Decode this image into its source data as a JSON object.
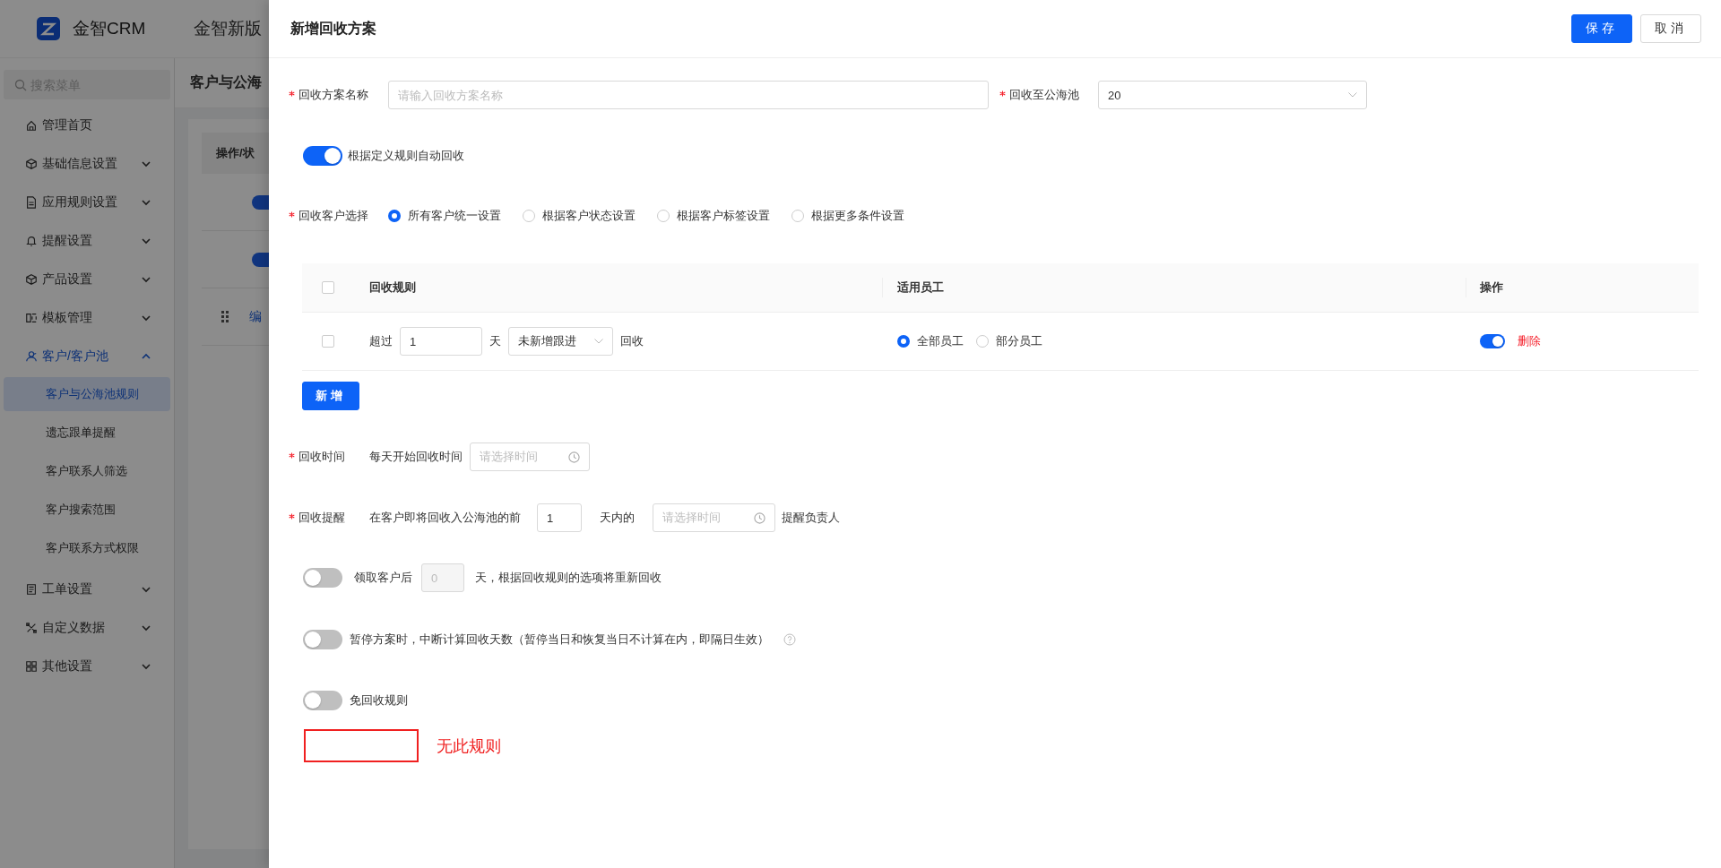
{
  "app": {
    "logo": "金智CRM",
    "title": "金智新版"
  },
  "sidebar": {
    "search_placeholder": "搜索菜单",
    "items": [
      {
        "label": "管理首页",
        "kind": "link",
        "selected": false
      },
      {
        "label": "基础信息设置",
        "kind": "group",
        "selected": false,
        "expanded": false
      },
      {
        "label": "应用规则设置",
        "kind": "group",
        "selected": false,
        "expanded": false
      },
      {
        "label": "提醒设置",
        "kind": "group",
        "selected": false,
        "expanded": false
      },
      {
        "label": "产品设置",
        "kind": "group",
        "selected": false,
        "expanded": false
      },
      {
        "label": "模板管理",
        "kind": "group",
        "selected": false,
        "expanded": false
      },
      {
        "label": "客户/客户池",
        "kind": "group",
        "selected": true,
        "expanded": true,
        "children": [
          {
            "label": "客户与公海池规则",
            "selected": true
          },
          {
            "label": "遗忘跟单提醒",
            "selected": false
          },
          {
            "label": "客户联系人筛选",
            "selected": false
          },
          {
            "label": "客户搜索范围",
            "selected": false
          },
          {
            "label": "客户联系方式权限",
            "selected": false
          }
        ]
      },
      {
        "label": "工单设置",
        "kind": "group",
        "selected": false,
        "expanded": false
      },
      {
        "label": "自定义数据",
        "kind": "group",
        "selected": false,
        "expanded": false
      },
      {
        "label": "其他设置",
        "kind": "group",
        "selected": false,
        "expanded": false
      }
    ]
  },
  "page": {
    "title": "客户与公海",
    "table_header": "操作/状",
    "rows": [
      {
        "kind": "toggle",
        "on": true
      },
      {
        "kind": "toggle",
        "on": true
      },
      {
        "kind": "link",
        "text": "编"
      }
    ]
  },
  "drawer": {
    "title": "新增回收方案",
    "buttons": [
      {
        "label": "保存",
        "kind": "primary"
      },
      {
        "label": "取消",
        "kind": "default"
      }
    ],
    "name_field": {
      "label": "回收方案名称",
      "required": true,
      "placeholder": "请输入回收方案名称"
    },
    "pool_field": {
      "label": "回收至公海池",
      "required": true,
      "value": "20"
    },
    "auto_recycle": {
      "label": "根据定义规则自动回收",
      "on": true
    },
    "customer_select": {
      "label": "回收客户选择",
      "required": true,
      "options": [
        {
          "label": "所有客户统一设置",
          "selected": true
        },
        {
          "label": "根据客户状态设置",
          "selected": false
        },
        {
          "label": "根据客户标签设置",
          "selected": false
        },
        {
          "label": "根据更多条件设置",
          "selected": false
        }
      ]
    },
    "rules_table": {
      "columns": [
        "回收规则",
        "适用员工",
        "操作"
      ],
      "header_checked": false,
      "rows": [
        {
          "checked": false,
          "prefix": "超过",
          "days": "1",
          "unit": "天",
          "condition": "未新增跟进",
          "suffix": "回收",
          "staff_options": [
            {
              "label": "全部员工",
              "selected": true
            },
            {
              "label": "部分员工",
              "selected": false
            }
          ],
          "enabled": true,
          "delete": "删除"
        }
      ]
    },
    "add_button": "新增",
    "recycle_time": {
      "label": "回收时间",
      "required": true,
      "text": "每天开始回收时间",
      "placeholder": "请选择时间"
    },
    "reminder": {
      "label": "回收提醒",
      "required": true,
      "before": "在客户即将回收入公海池的前",
      "days": "1",
      "middle": "天内的",
      "placeholder": "请选择时间",
      "after": "提醒负责人"
    },
    "switches": [
      {
        "kind": "claim",
        "on": false,
        "before": "领取客户后",
        "value": "0",
        "disabled": true,
        "after": "天，根据回收规则的选项将重新回收"
      },
      {
        "kind": "pause",
        "on": false,
        "label": "暂停方案时，中断计算回收天数（暂停当日和恢复当日不计算在内，即隔日生效）"
      },
      {
        "kind": "exempt",
        "on": false,
        "label": "免回收规则"
      }
    ],
    "annotation": {
      "text": "无此规则"
    }
  }
}
